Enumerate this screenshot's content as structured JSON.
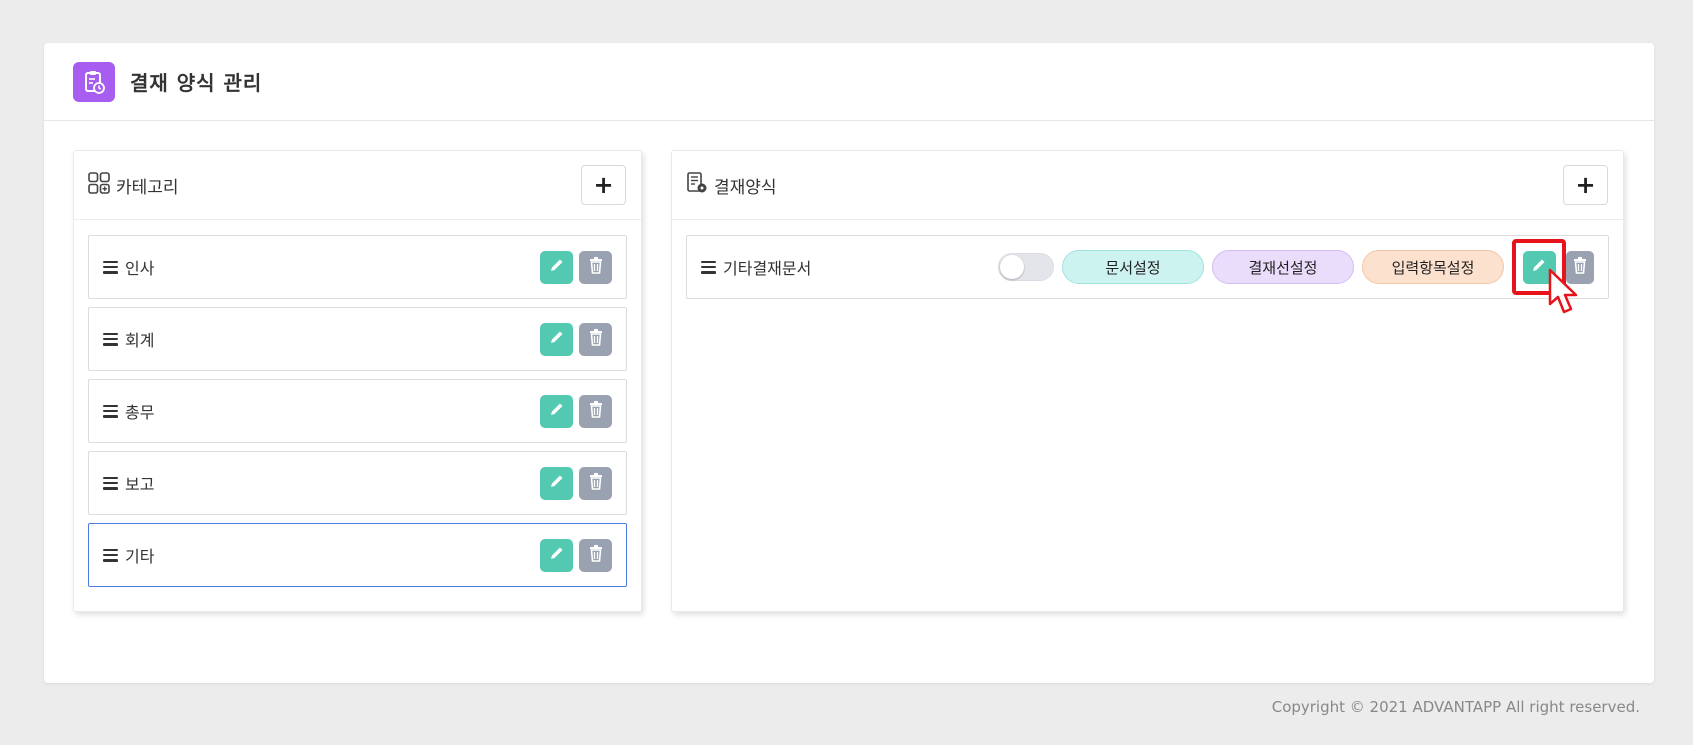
{
  "header": {
    "title": "결재 양식 관리",
    "logo_icon": "clipboard-icon",
    "logo_color": "#a65df0"
  },
  "category_panel": {
    "title": "카테고리",
    "add_label": "+",
    "items": [
      {
        "label": "인사"
      },
      {
        "label": "회계"
      },
      {
        "label": "총무"
      },
      {
        "label": "보고"
      },
      {
        "label": "기타",
        "selected": true
      }
    ]
  },
  "form_panel": {
    "title": "결재양식",
    "add_label": "+",
    "items": [
      {
        "label": "기타결재문서",
        "toggle_on": false,
        "buttons": {
          "doc_settings": "문서설정",
          "approval_line_settings": "결재선설정",
          "input_field_settings": "입력항목설정"
        }
      }
    ]
  },
  "colors": {
    "edit": "#52c9b0",
    "delete": "#9aa2b1",
    "selected_border": "#4b7be5",
    "highlight": "#e8141c"
  },
  "footer": {
    "copyright": "Copyright © 2021 ADVANTAPP All right reserved."
  }
}
